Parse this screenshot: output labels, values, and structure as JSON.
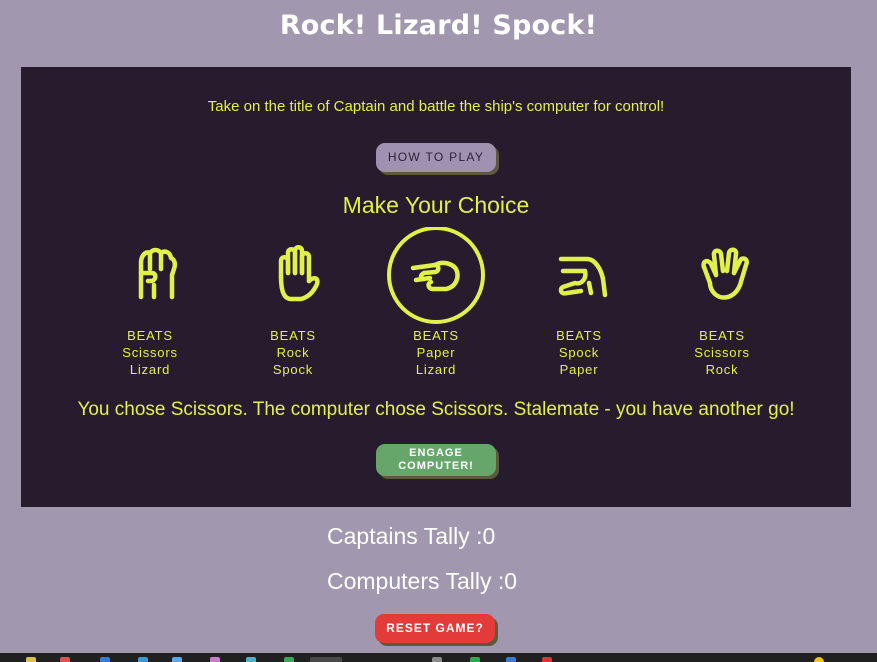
{
  "header": {
    "title": "Rock! Lizard! Spock!"
  },
  "panel": {
    "intro": "Take on the title of Captain and battle the ship's computer for control!",
    "how_to_play_label": "HOW TO PLAY",
    "choice_heading": "Make Your Choice",
    "choices": [
      {
        "icon": "rock-fist-icon",
        "beats_label": "BEATS",
        "beats": [
          "Scissors",
          "Lizard"
        ],
        "selected": false
      },
      {
        "icon": "paper-hand-icon",
        "beats_label": "BEATS",
        "beats": [
          "Rock",
          "Spock"
        ],
        "selected": false
      },
      {
        "icon": "scissors-hand-icon",
        "beats_label": "BEATS",
        "beats": [
          "Paper",
          "Lizard"
        ],
        "selected": true
      },
      {
        "icon": "lizard-hand-icon",
        "beats_label": "BEATS",
        "beats": [
          "Spock",
          "Paper"
        ],
        "selected": false
      },
      {
        "icon": "spock-hand-icon",
        "beats_label": "BEATS",
        "beats": [
          "Scissors",
          "Rock"
        ],
        "selected": false
      }
    ],
    "result_text": "You chose Scissors. The computer chose Scissors. Stalemate - you have another go!",
    "engage_label": "ENGAGE COMPUTER!"
  },
  "tally": {
    "captain": "Captains Tally :0",
    "computer": "Computers Tally :0"
  },
  "reset_label": "RESET GAME?",
  "colors": {
    "background": "#a197ae",
    "panel": "#261c2e",
    "accent": "#e0f24a",
    "engage": "#67a66b",
    "reset": "#e23b39"
  }
}
